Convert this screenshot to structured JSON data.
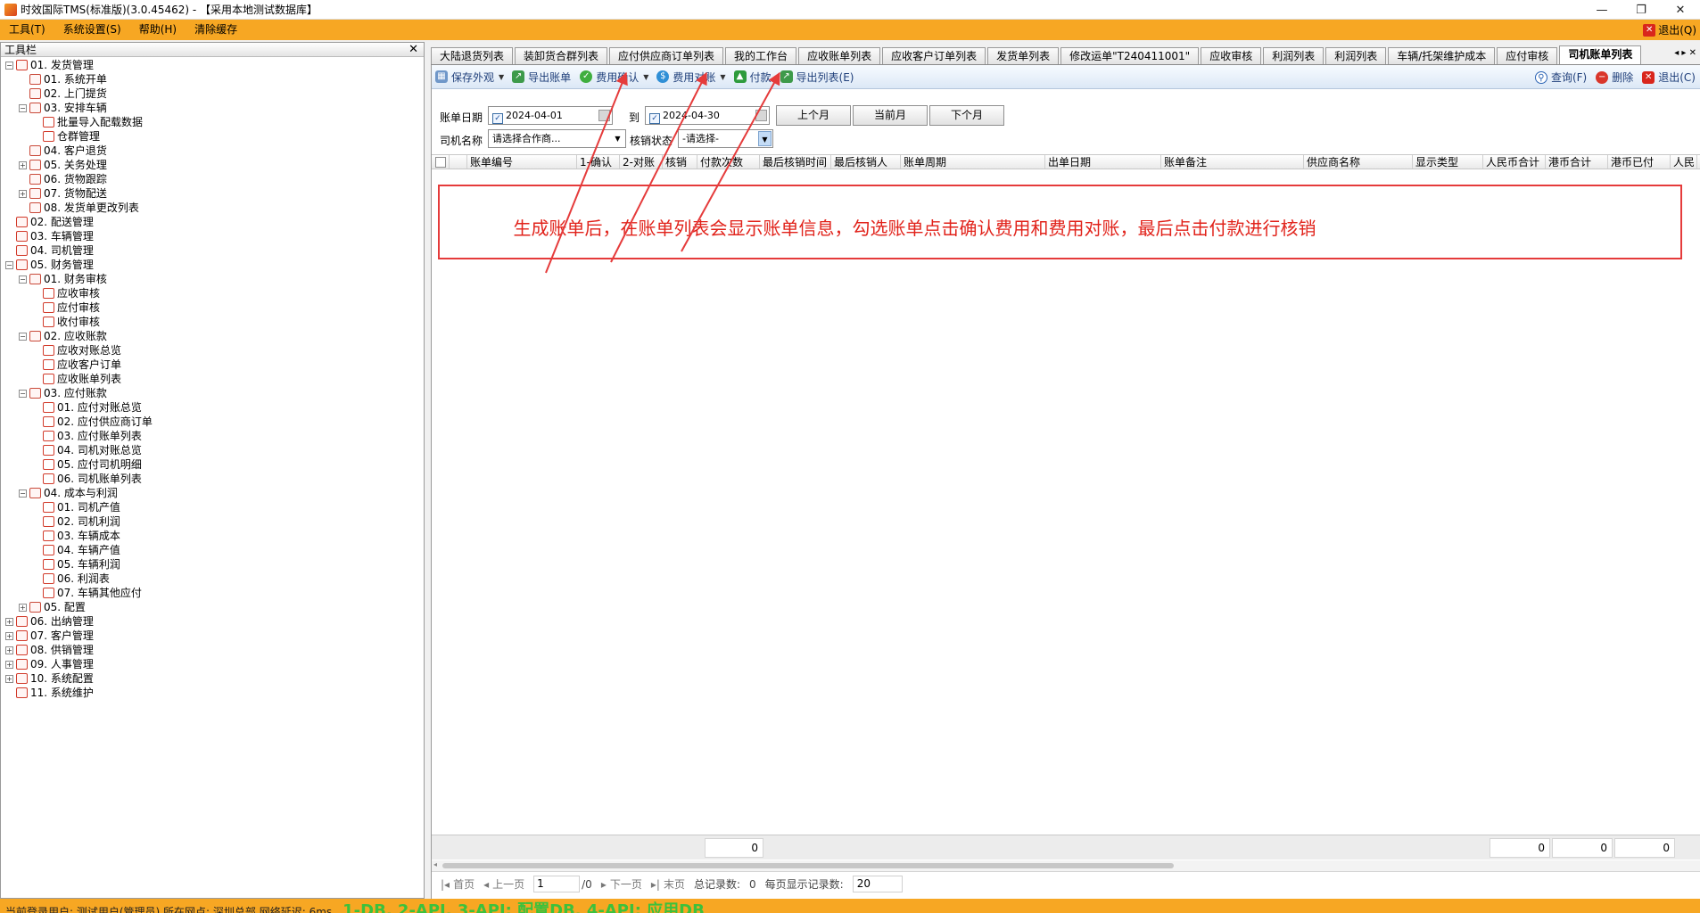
{
  "window": {
    "title": "时效国际TMS(标准版)(3.0.45462) - 【采用本地测试数据库】",
    "minimize": "—",
    "restore": "❐",
    "close": "✕"
  },
  "menu": {
    "items": [
      "工具(T)",
      "系统设置(S)",
      "帮助(H)",
      "清除缓存"
    ],
    "exit_label": "退出(Q)"
  },
  "toolpanel": {
    "title": "工具栏",
    "close": "✕",
    "tree": [
      {
        "label": "01. 发货管理",
        "level": 0,
        "exp": "-"
      },
      {
        "label": "01. 系统开单",
        "level": 1,
        "exp": ""
      },
      {
        "label": "02. 上门提货",
        "level": 1,
        "exp": ""
      },
      {
        "label": "03. 安排车辆",
        "level": 1,
        "exp": "-"
      },
      {
        "label": "批量导入配载数据",
        "level": 2,
        "exp": ""
      },
      {
        "label": "仓群管理",
        "level": 2,
        "exp": ""
      },
      {
        "label": "04. 客户退货",
        "level": 1,
        "exp": ""
      },
      {
        "label": "05. 关务处理",
        "level": 1,
        "exp": "+"
      },
      {
        "label": "06. 货物跟踪",
        "level": 1,
        "exp": ""
      },
      {
        "label": "07. 货物配送",
        "level": 1,
        "exp": "+"
      },
      {
        "label": "08. 发货单更改列表",
        "level": 1,
        "exp": ""
      },
      {
        "label": "02. 配送管理",
        "level": 0,
        "exp": ""
      },
      {
        "label": "03. 车辆管理",
        "level": 0,
        "exp": ""
      },
      {
        "label": "04. 司机管理",
        "level": 0,
        "exp": ""
      },
      {
        "label": "05. 财务管理",
        "level": 0,
        "exp": "-"
      },
      {
        "label": "01. 财务审核",
        "level": 1,
        "exp": "-"
      },
      {
        "label": "应收审核",
        "level": 2,
        "exp": ""
      },
      {
        "label": "应付审核",
        "level": 2,
        "exp": ""
      },
      {
        "label": "收付审核",
        "level": 2,
        "exp": ""
      },
      {
        "label": "02. 应收账款",
        "level": 1,
        "exp": "-"
      },
      {
        "label": "应收对账总览",
        "level": 2,
        "exp": ""
      },
      {
        "label": "应收客户订单",
        "level": 2,
        "exp": ""
      },
      {
        "label": "应收账单列表",
        "level": 2,
        "exp": ""
      },
      {
        "label": "03. 应付账款",
        "level": 1,
        "exp": "-"
      },
      {
        "label": "01. 应付对账总览",
        "level": 2,
        "exp": ""
      },
      {
        "label": "02. 应付供应商订单",
        "level": 2,
        "exp": ""
      },
      {
        "label": "03. 应付账单列表",
        "level": 2,
        "exp": ""
      },
      {
        "label": "04. 司机对账总览",
        "level": 2,
        "exp": ""
      },
      {
        "label": "05. 应付司机明细",
        "level": 2,
        "exp": ""
      },
      {
        "label": "06. 司机账单列表",
        "level": 2,
        "exp": ""
      },
      {
        "label": "04. 成本与利润",
        "level": 1,
        "exp": "-"
      },
      {
        "label": "01. 司机产值",
        "level": 2,
        "exp": ""
      },
      {
        "label": "02. 司机利润",
        "level": 2,
        "exp": ""
      },
      {
        "label": "03. 车辆成本",
        "level": 2,
        "exp": ""
      },
      {
        "label": "04. 车辆产值",
        "level": 2,
        "exp": ""
      },
      {
        "label": "05. 车辆利润",
        "level": 2,
        "exp": ""
      },
      {
        "label": "06. 利润表",
        "level": 2,
        "exp": ""
      },
      {
        "label": "07. 车辆其他应付",
        "level": 2,
        "exp": ""
      },
      {
        "label": "05. 配置",
        "level": 1,
        "exp": "+"
      },
      {
        "label": "06. 出纳管理",
        "level": 0,
        "exp": "+"
      },
      {
        "label": "07. 客户管理",
        "level": 0,
        "exp": "+"
      },
      {
        "label": "08. 供销管理",
        "level": 0,
        "exp": "+"
      },
      {
        "label": "09. 人事管理",
        "level": 0,
        "exp": "+"
      },
      {
        "label": "10. 系统配置",
        "level": 0,
        "exp": "+"
      },
      {
        "label": "11. 系统维护",
        "level": 0,
        "exp": ""
      }
    ]
  },
  "tabs": [
    {
      "label": "大陆退货列表",
      "active": false
    },
    {
      "label": "装卸货合群列表",
      "active": false
    },
    {
      "label": "应付供应商订单列表",
      "active": false
    },
    {
      "label": "我的工作台",
      "active": false
    },
    {
      "label": "应收账单列表",
      "active": false
    },
    {
      "label": "应收客户订单列表",
      "active": false
    },
    {
      "label": "发货单列表",
      "active": false
    },
    {
      "label": "修改运单\"T240411001\"",
      "active": false
    },
    {
      "label": "应收审核",
      "active": false
    },
    {
      "label": "利润列表",
      "active": false
    },
    {
      "label": "利润列表",
      "active": false
    },
    {
      "label": "车辆/托架维护成本",
      "active": false
    },
    {
      "label": "应付审核",
      "active": false
    },
    {
      "label": "司机账单列表",
      "active": true
    }
  ],
  "tab_nav": "◂ ▸ ✕",
  "toolbar": {
    "save_view": "保存外观",
    "export_bill": "导出账单",
    "confirm_fee": "费用确认",
    "reconcile_fee": "费用对账",
    "pay": "付款",
    "export_list": "导出列表(E)",
    "query": "查询(F)",
    "delete": "删除",
    "exit": "退出(C)"
  },
  "filter": {
    "bill_date_label": "账单日期",
    "date_from": "2024-04-01",
    "to_label": "到",
    "date_to": "2024-04-30",
    "prev_month": "上个月",
    "current_month": "当前月",
    "next_month": "下个月",
    "driver_label": "司机名称",
    "driver_placeholder": "请选择合作商...",
    "status_label": "核销状态",
    "status_value": "-请选择-"
  },
  "grid": {
    "columns": [
      "账单编号",
      "1-确认",
      "2-对账",
      "核销",
      "付款次数",
      "最后核销时间",
      "最后核销人",
      "账单周期",
      "出单日期",
      "账单备注",
      "供应商名称",
      "显示类型",
      "人民币合计",
      "港币合计",
      "港币已付",
      "人民"
    ]
  },
  "annotation": {
    "text": "生成账单后，在账单列表会显示账单信息，勾选账单点击确认费用和费用对账，最后点击付款进行核销",
    "color": "#e1231b"
  },
  "totals": [
    "0",
    "0",
    "0",
    "0"
  ],
  "pager": {
    "first": "首页",
    "prev": "上一页",
    "page_value": "1",
    "page_total": "/0",
    "next": "下一页",
    "last": "末页",
    "total_label": "总记录数:",
    "total_value": "0",
    "per_page_label": "每页显示记录数:",
    "per_page_value": "20"
  },
  "status": {
    "text": "当前登录用户:  测试用户(管理员)  所在网点:  深圳总部  网络延迟: 6ms",
    "db_text": "1-DB, 2-API, 3-API: 配置DB, 4-API: 应用DB"
  }
}
